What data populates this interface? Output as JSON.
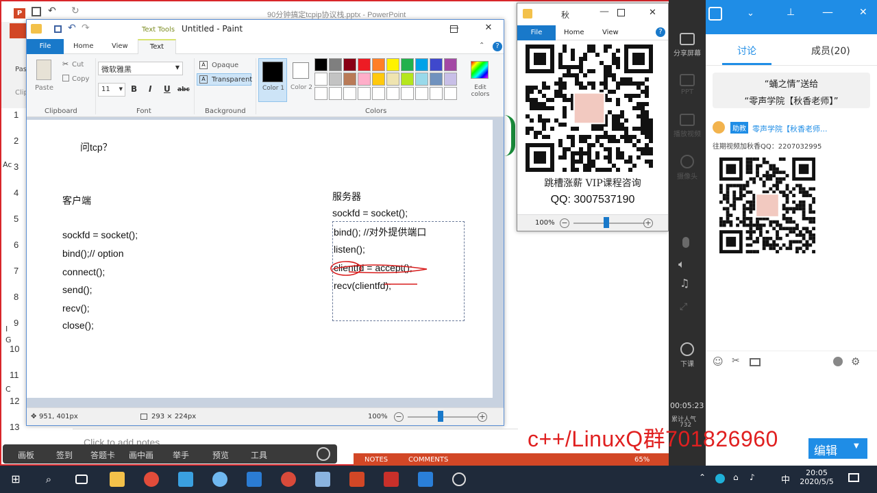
{
  "powerpoint": {
    "title": "90分钟搞定tcpip协议栈.pptx - PowerPoint",
    "logo": "P",
    "slide_numbers": [
      "1",
      "2",
      "3",
      "4",
      "5",
      "6",
      "7",
      "8",
      "9",
      "10",
      "11",
      "12",
      "13"
    ],
    "notes_placeholder": "Click to add notes",
    "status": {
      "notes": "NOTES",
      "comments": "COMMENTS",
      "zoom": "65%"
    },
    "left_fragments": [
      "Pas",
      "Clip",
      "Ac",
      "I",
      "G",
      "C"
    ]
  },
  "classroom_toolbar": {
    "items": [
      "画板",
      "签到",
      "答题卡",
      "画中画",
      "举手",
      "预览",
      "工具"
    ]
  },
  "paint": {
    "title": "Untitled - Paint",
    "context_tab": "Text Tools",
    "tabs": {
      "file": "File",
      "home": "Home",
      "view": "View",
      "text": "Text"
    },
    "clipboard": {
      "paste": "Paste",
      "cut": "Cut",
      "copy": "Copy",
      "label": "Clipboard"
    },
    "font": {
      "family": "微软雅黑",
      "size": "11",
      "bold": "B",
      "italic": "I",
      "underline": "U",
      "strike": "abc",
      "label": "Font"
    },
    "background": {
      "opaque": "Opaque",
      "transparent": "Transparent",
      "label": "Background"
    },
    "colors": {
      "color1": "Color 1",
      "color2": "Color 2",
      "edit": "Edit colors",
      "label": "Colors",
      "palette_row1": [
        "#000000",
        "#7f7f7f",
        "#880015",
        "#ed1c24",
        "#ff7f27",
        "#fff200",
        "#22b14c",
        "#00a2e8",
        "#3f48cc",
        "#a349a4"
      ],
      "palette_row2": [
        "#ffffff",
        "#c3c3c3",
        "#b97a57",
        "#ffaec9",
        "#ffc90e",
        "#efe4b0",
        "#b5e61d",
        "#99d9ea",
        "#7092be",
        "#c8bfe7"
      ]
    },
    "canvas": {
      "question": "问tcp？",
      "client": {
        "heading": "客户端",
        "lines": [
          "sockfd = socket();",
          "bind();// option",
          "connect();",
          "send();",
          "recv();",
          "close();"
        ]
      },
      "server": {
        "heading": "服务器",
        "lines": [
          "sockfd = socket();",
          "bind(); //对外提供端口",
          "listen();",
          "clientfd = accept();",
          "recv(clientfd);"
        ]
      }
    },
    "status": {
      "cursor": "951, 401px",
      "selection": "293 × 224px",
      "zoom": "100%"
    }
  },
  "qr_window": {
    "title": "秋",
    "tabs": {
      "file": "File",
      "home": "Home",
      "view": "View"
    },
    "caption": "跳槽涨薪 VIP课程咨询",
    "qq": "QQ: 3007537190",
    "zoom": "100%"
  },
  "sidebar": {
    "items": [
      "分享屏幕",
      "PPT",
      "播放视频",
      "摄像头",
      "下课"
    ],
    "timer": "00:05:23",
    "count_label": "累计人气",
    "count": "732"
  },
  "chat": {
    "tabs": [
      "讨论",
      "成员(20)"
    ],
    "gift_line1": "“蛹之情”送给",
    "gift_line2": "“零声学院【秋香老师】”",
    "badge": "助教",
    "sender": "零声学院【秋香老师...",
    "message": "往期视频加秋香QQ：2207032995",
    "send": "编辑"
  },
  "banner": "c++/LinuxQ群701826960",
  "taskbar": {
    "time": "20:05",
    "date": "2020/5/5",
    "ime": "中"
  }
}
